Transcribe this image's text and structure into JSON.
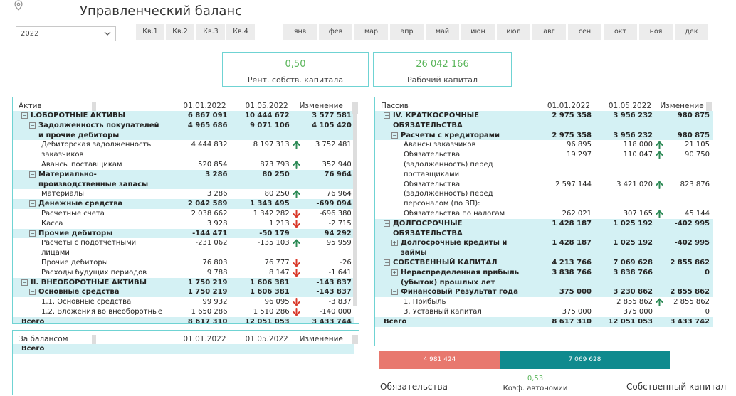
{
  "title": "Управленческий баланс",
  "year_filter": {
    "value": "2022"
  },
  "quarters": [
    "Кв.1",
    "Кв.2",
    "Кв.3",
    "Кв.4"
  ],
  "months": [
    "янв",
    "фев",
    "мар",
    "апр",
    "май",
    "июн",
    "июл",
    "авг",
    "сен",
    "окт",
    "ноя",
    "дек"
  ],
  "kpis": [
    {
      "value": "0,50",
      "label": "Рент. собств. капитала"
    },
    {
      "value": "26 042 166",
      "label": "Рабочий капитал"
    }
  ],
  "colors": {
    "accent": "#6fd3d3",
    "highlight": "#d4f1f4",
    "kpi_value": "#5ab55a",
    "arrow_up": "#2e8b57",
    "arrow_down": "#d93a2b",
    "bar_liabilities": "#e8786e",
    "bar_equity": "#0f8a8e"
  },
  "assets": {
    "headers": [
      "Актив",
      "01.01.2022",
      "01.05.2022",
      "Изменение"
    ],
    "rows": [
      {
        "label": "I.ОБОРОТНЫЕ АКТИВЫ",
        "level": 0,
        "expand": "minus",
        "bold": true,
        "hl": true,
        "v1": "6 867 091",
        "v2": "10 444 672",
        "chg": "3 577 581"
      },
      {
        "label": "Задолженность покупателей и прочие дебиторы",
        "level": 1,
        "expand": "minus",
        "bold": true,
        "hl": true,
        "v1": "4 965 686",
        "v2": "9 071 106",
        "chg": "4 105 420"
      },
      {
        "label": "Дебиторская задолженность заказчиков",
        "level": 2,
        "v1": "4 444 832",
        "v2": "8 197 313",
        "arrow": "up-arrow",
        "chg": "3 752 481"
      },
      {
        "label": "Авансы поставщикам",
        "level": 2,
        "v1": "520 854",
        "v2": "873 793",
        "arrow": "up-arrow",
        "chg": "352 940"
      },
      {
        "label": "Материально-производственные запасы",
        "level": 1,
        "expand": "minus",
        "bold": true,
        "hl": true,
        "v1": "3 286",
        "v2": "80 250",
        "chg": "76 964"
      },
      {
        "label": "Материалы",
        "level": 2,
        "v1": "3 286",
        "v2": "80 250",
        "arrow": "up-arrow",
        "chg": "76 964"
      },
      {
        "label": "Денежные средства",
        "level": 1,
        "expand": "minus",
        "bold": true,
        "hl": true,
        "v1": "2 042 589",
        "v2": "1 343 495",
        "chg": "-699 094"
      },
      {
        "label": "Расчетные счета",
        "level": 2,
        "v1": "2 038 662",
        "v2": "1 342 282",
        "arrow": "down-arrow",
        "chg": "-696 380"
      },
      {
        "label": "Касса",
        "level": 2,
        "v1": "3 928",
        "v2": "1 213",
        "arrow": "down-arrow",
        "chg": "-2 715"
      },
      {
        "label": "Прочие дебиторы",
        "level": 1,
        "expand": "minus",
        "bold": true,
        "hl": true,
        "v1": "-144 471",
        "v2": "-50 179",
        "chg": "94 292"
      },
      {
        "label": "Расчеты с подотчетными лицами",
        "level": 2,
        "v1": "-231 062",
        "v2": "-135 103",
        "arrow": "up-arrow",
        "chg": "95 959"
      },
      {
        "label": "Прочие дебиторы",
        "level": 2,
        "v1": "76 803",
        "v2": "76 777",
        "arrow": "down-arrow",
        "chg": "-26"
      },
      {
        "label": "Расходы будущих периодов",
        "level": 2,
        "v1": "9 788",
        "v2": "8 147",
        "arrow": "down-arrow",
        "chg": "-1 641"
      },
      {
        "label": "II. ВНЕОБОРОТНЫЕ АКТИВЫ",
        "level": 0,
        "expand": "minus",
        "bold": true,
        "hl": true,
        "v1": "1 750 219",
        "v2": "1 606 381",
        "chg": "-143 837"
      },
      {
        "label": "Основные средства",
        "level": 1,
        "expand": "minus",
        "bold": true,
        "hl": true,
        "v1": "1 750 219",
        "v2": "1 606 381",
        "chg": "-143 837"
      },
      {
        "label": "1.1. Основные средства",
        "level": 2,
        "v1": "99 932",
        "v2": "96 095",
        "arrow": "down-arrow",
        "chg": "-3 837"
      },
      {
        "label": "1.2. Вложения во внеоборотные",
        "level": 2,
        "v1": "1 650 286",
        "v2": "1 510 286",
        "arrow": "down-arrow",
        "chg": "-140 000"
      },
      {
        "label": "Всего",
        "level": 0,
        "bold": true,
        "hl": true,
        "v1": "8 617 310",
        "v2": "12 051 053",
        "chg": "3 433 744"
      }
    ]
  },
  "offbalance": {
    "headers": [
      "За балансом",
      "01.01.2022",
      "01.05.2022",
      "Изменение"
    ],
    "rows": [
      {
        "label": "Всего",
        "level": 0,
        "bold": true,
        "hl": true,
        "v1": "",
        "v2": "",
        "chg": ""
      }
    ]
  },
  "liabilities": {
    "headers": [
      "Пассив",
      "01.01.2022",
      "01.05.2022",
      "Изменение"
    ],
    "rows": [
      {
        "label": "IV. КРАТКОСРОЧНЫЕ ОБЯЗАТЕЛЬСТВА",
        "level": 0,
        "expand": "minus",
        "bold": true,
        "hl": true,
        "v1": "2 975 358",
        "v2": "3 956 232",
        "chg": "980 875"
      },
      {
        "label": "Расчеты с кредиторами",
        "level": 1,
        "expand": "minus",
        "bold": true,
        "hl": true,
        "v1": "2 975 358",
        "v2": "3 956 232",
        "chg": "980 875"
      },
      {
        "label": "Авансы заказчиков",
        "level": 2,
        "v1": "96 895",
        "v2": "118 000",
        "arrow": "up-arrow",
        "chg": "21 105"
      },
      {
        "label": "Обязательства (задолженность) перед поставщиками",
        "level": 2,
        "v1": "19 297",
        "v2": "110 047",
        "arrow": "up-arrow",
        "chg": "90 750"
      },
      {
        "label": "Обязательства (задолженность) перед персоналом (по ЗП):",
        "level": 2,
        "v1": "2 597 144",
        "v2": "3 421 020",
        "arrow": "up-arrow",
        "chg": "823 876"
      },
      {
        "label": "Обязательства по налогам",
        "level": 2,
        "v1": "262 021",
        "v2": "307 165",
        "arrow": "up-arrow",
        "chg": "45 144"
      },
      {
        "label": "ДОЛГОСРОЧНЫЕ ОБЯЗАТЕЛЬСТВА",
        "level": 0,
        "expand": "minus",
        "bold": true,
        "hl": true,
        "v1": "1 428 187",
        "v2": "1 025 192",
        "chg": "-402 995"
      },
      {
        "label": "Долгосрочные кредиты и займы",
        "level": 1,
        "expand": "plus",
        "bold": true,
        "hl": true,
        "v1": "1 428 187",
        "v2": "1 025 192",
        "chg": "-402 995"
      },
      {
        "label": "СОБСТВЕННЫЙ КАПИТАЛ",
        "level": 0,
        "expand": "minus",
        "bold": true,
        "hl": true,
        "v1": "4 213 766",
        "v2": "7 069 628",
        "chg": "2 855 862"
      },
      {
        "label": "Нераспределенная прибыль (убыток) прошлых лет",
        "level": 1,
        "expand": "plus",
        "bold": true,
        "hl": true,
        "v1": "3 838 766",
        "v2": "3 838 766",
        "chg": "0"
      },
      {
        "label": "Финансовый Результат года",
        "level": 1,
        "expand": "minus",
        "bold": true,
        "hl": true,
        "v1": "375 000",
        "v2": "3 230 862",
        "chg": "2 855 862"
      },
      {
        "label": "1. Прибыль",
        "level": 2,
        "v1": "",
        "v2": "2 855 862",
        "arrow": "up-arrow",
        "chg": "2 855 862"
      },
      {
        "label": "3. Уставный капитал",
        "level": 2,
        "v1": "375 000",
        "v2": "375 000",
        "chg": "0"
      },
      {
        "label": "Всего",
        "level": 0,
        "bold": true,
        "hl": true,
        "v1": "8 617 310",
        "v2": "12 051 053",
        "chg": "3 433 742"
      }
    ]
  },
  "bottom": {
    "liabilities_value": 4981424,
    "liabilities_text": "4 981 424",
    "equity_value": 7069628,
    "equity_text": "7 069 628",
    "autonomy_value": "0,53",
    "autonomy_label": "Коэф. автономии",
    "left_label": "Обязательства",
    "right_label": "Собственный капитал"
  }
}
